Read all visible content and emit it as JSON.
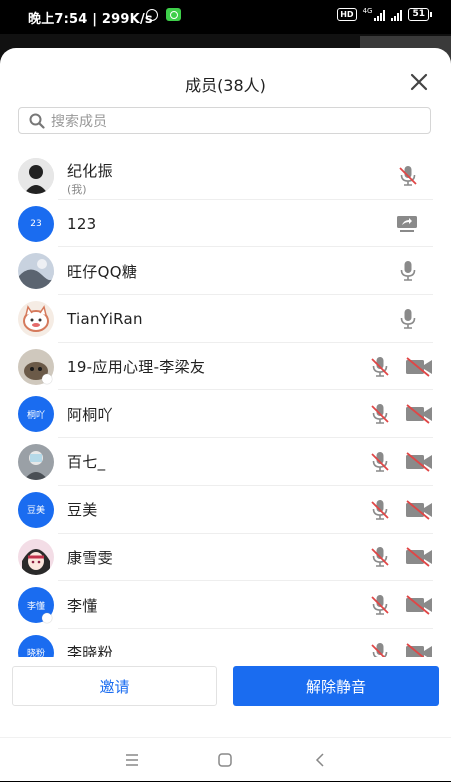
{
  "status_bar": {
    "time_speed": "晚上7:54 | 299K/s",
    "hd": "HD",
    "network": "4G",
    "battery": "51"
  },
  "header": {
    "title": "成员(38人)"
  },
  "search": {
    "placeholder": "搜索成员"
  },
  "members": [
    {
      "name": "纪化振",
      "sub": "(我)",
      "avatar": "photo-dark",
      "mic": "muted",
      "camera": false
    },
    {
      "name": "123",
      "avatar_text": "23",
      "avatar": "blue-text",
      "share": true
    },
    {
      "name": "旺仔QQ糖",
      "avatar": "photo-sky",
      "mic": "on",
      "camera": false
    },
    {
      "name": "TianYiRan",
      "avatar": "photo-cat",
      "mic": "on",
      "camera": false
    },
    {
      "name": "19-应用心理-李梁友",
      "avatar": "photo-pet",
      "mic": "muted",
      "camera": true
    },
    {
      "name": "阿桐吖",
      "avatar_text": "桐吖",
      "avatar": "blue-text",
      "mic": "muted",
      "camera": true
    },
    {
      "name": "百七_",
      "avatar": "photo-gray",
      "mic": "muted",
      "camera": true
    },
    {
      "name": "豆美",
      "avatar_text": "豆美",
      "avatar": "blue-text",
      "mic": "muted",
      "camera": true
    },
    {
      "name": "康雪雯",
      "avatar": "photo-anime",
      "mic": "muted",
      "camera": true
    },
    {
      "name": "李懂",
      "avatar_text": "李懂",
      "avatar": "blue-text",
      "mic": "muted",
      "camera": true
    },
    {
      "name": "李晓粉",
      "avatar_text": "晓粉",
      "avatar": "blue-text",
      "mic": "muted",
      "camera": true
    }
  ],
  "actions": {
    "invite": "邀请",
    "unmute_all": "解除静音"
  },
  "colors": {
    "accent": "#1a6cf0",
    "muted_red": "#e04646",
    "icon_gray": "#8a8a8a"
  }
}
